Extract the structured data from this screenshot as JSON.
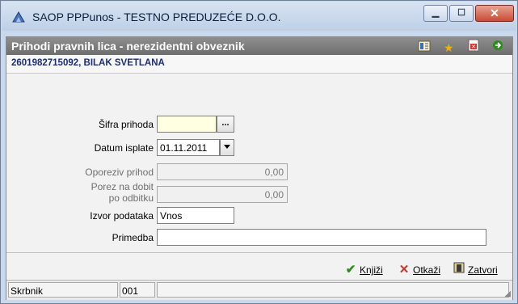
{
  "window": {
    "title": "SAOP PPPunos - TESTNO PREDUZEĆE D.O.O."
  },
  "header": {
    "title": "Prihodi pravnih lica - nerezidentni obveznik",
    "icons": [
      "list-view-icon",
      "favorite-star-icon",
      "document-delete-icon",
      "exit-door-icon"
    ]
  },
  "subheader": {
    "text": "2601982715092, BILAK SVETLANA"
  },
  "form": {
    "sifra_prihoda": {
      "label": "Šifra prihoda",
      "value": "",
      "button": "..."
    },
    "datum_isplate": {
      "label": "Datum isplate",
      "value": "01.11.2011"
    },
    "oporeziv_prihod": {
      "label": "Oporeziv prihod",
      "value": "0,00"
    },
    "porez_na_dobit": {
      "label_line1": "Porez na dobit",
      "label_line2": "po odbitku",
      "value": "0,00"
    },
    "izvor_podataka": {
      "label": "Izvor podataka",
      "value": "Vnos"
    },
    "primedba": {
      "label": "Primedba",
      "value": ""
    }
  },
  "actions": {
    "knjizi_label": "Knjiži",
    "otkazi_label": "Otkaži",
    "zatvori_label": "Zatvori"
  },
  "status": {
    "user": "Skrbnik",
    "code": "001",
    "extra": ""
  },
  "colors": {
    "header_band": "#7f7f7f",
    "subheader_text": "#1c2e78",
    "required_field": "#ffffe1",
    "ok_green": "#2f8a1f",
    "cancel_red": "#c0392b"
  }
}
